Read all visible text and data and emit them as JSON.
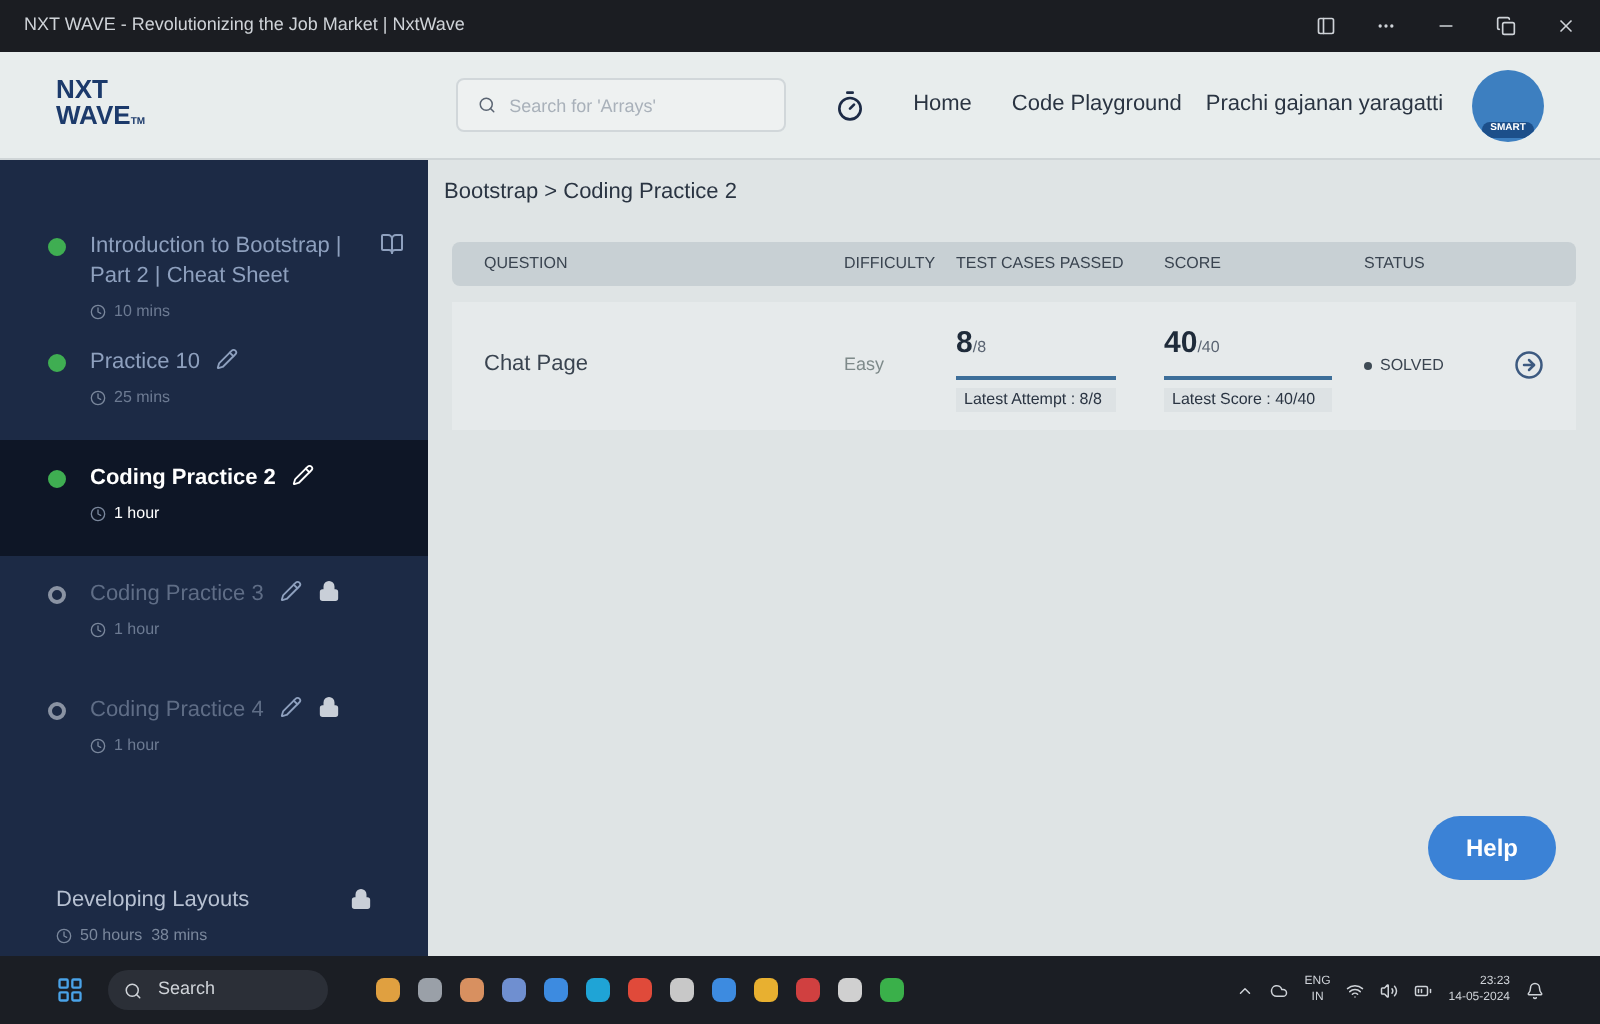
{
  "window": {
    "title": "NXT WAVE - Revolutionizing the Job Market | NxtWave"
  },
  "header": {
    "logo": [
      "NXT",
      "WAVE",
      "TM"
    ],
    "search": {
      "placeholder": "Search for 'Arrays'"
    },
    "nav": [
      "Home",
      "Code Playground"
    ],
    "user": "Prachi gajanan yaragatti",
    "avatar_badge": "SMART"
  },
  "sidebar": {
    "items": [
      {
        "kind": "reading",
        "title": "Introduction to Bootstrap | Part 2 | Cheat Sheet",
        "duration": "10 mins",
        "completed": true,
        "selected": false,
        "locked": false
      },
      {
        "kind": "practice",
        "title": "Practice 10",
        "duration": "25 mins",
        "completed": true,
        "selected": false,
        "locked": false
      },
      {
        "kind": "practice",
        "title": "Coding Practice 2",
        "duration": "1 hour",
        "completed": true,
        "selected": true,
        "locked": false
      },
      {
        "kind": "practice",
        "title": "Coding Practice 3",
        "duration": "1 hour",
        "completed": false,
        "selected": false,
        "locked": true
      },
      {
        "kind": "practice",
        "title": "Coding Practice 4",
        "duration": "1 hour",
        "completed": false,
        "selected": false,
        "locked": true
      }
    ],
    "next_topic": {
      "title": "Developing Layouts",
      "duration": "50 hours  38 mins",
      "locked": true
    }
  },
  "breadcrumb": "Bootstrap > Coding Practice 2",
  "table": {
    "columns": [
      "QUESTION",
      "DIFFICULTY",
      "TEST CASES PASSED",
      "SCORE",
      "STATUS"
    ],
    "rows": [
      {
        "question": "Chat Page",
        "difficulty": "Easy",
        "passed": "8",
        "passed_total": "/8",
        "passed_bar": {
          "level": 1
        },
        "latest_attempt": "Latest Attempt : 8/8",
        "score": "40",
        "score_total": "/40",
        "score_bar": {
          "level": 1
        },
        "latest_score": "Latest Score : 40/40",
        "status": {
          "label": "SOLVED",
          "color": "#3f4b55"
        }
      }
    ]
  },
  "help_button": "Help",
  "taskbar": {
    "search": "Search",
    "language": [
      "ENG",
      "IN"
    ],
    "time": "23:23",
    "date": "14-05-2024"
  }
}
